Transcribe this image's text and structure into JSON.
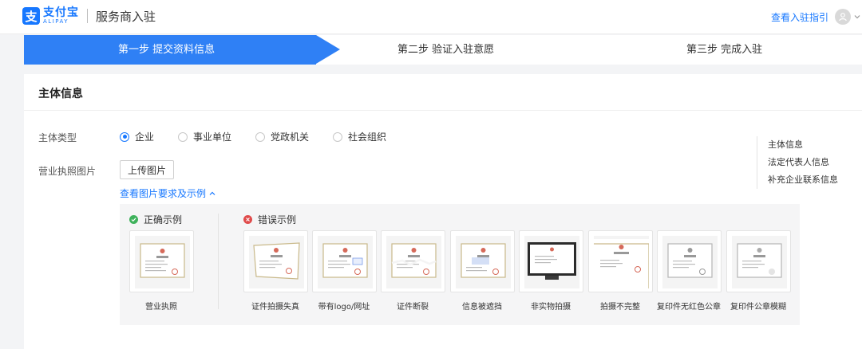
{
  "header": {
    "logo_mark": "支",
    "logo_cn": "支付宝",
    "logo_en": "ALIPAY",
    "title": "服务商入驻",
    "guide_link": "查看入驻指引"
  },
  "stepper": {
    "steps": [
      {
        "label": "第一步 提交资料信息",
        "active": true
      },
      {
        "label": "第二步 验证入驻意愿",
        "active": false
      },
      {
        "label": "第三步 完成入驻",
        "active": false
      }
    ]
  },
  "form": {
    "section_title": "主体信息",
    "entity_type_label": "主体类型",
    "entity_options": [
      {
        "label": "企业",
        "checked": true
      },
      {
        "label": "事业单位",
        "checked": false
      },
      {
        "label": "党政机关",
        "checked": false
      },
      {
        "label": "社会组织",
        "checked": false
      }
    ],
    "license_label": "营业执照图片",
    "upload_button": "上传图片",
    "example_link": "查看图片要求及示例"
  },
  "side_nav": {
    "items": [
      "主体信息",
      "法定代表人信息",
      "补充企业联系信息"
    ]
  },
  "examples": {
    "correct_title": "正确示例",
    "wrong_title": "错误示例",
    "correct_items": [
      {
        "label": "营业执照"
      }
    ],
    "wrong_items": [
      {
        "label": "证件拍摄失真"
      },
      {
        "label": "带有logo/网址"
      },
      {
        "label": "证件断裂"
      },
      {
        "label": "信息被遮挡"
      },
      {
        "label": "非实物拍摄"
      },
      {
        "label": "拍摄不完整"
      },
      {
        "label": "复印件无红色公章"
      },
      {
        "label": "复印件公章模糊"
      }
    ]
  },
  "colors": {
    "primary": "#1677ff",
    "step_active": "#2f80f5",
    "success": "#3fb25c",
    "error": "#e04b4b"
  }
}
